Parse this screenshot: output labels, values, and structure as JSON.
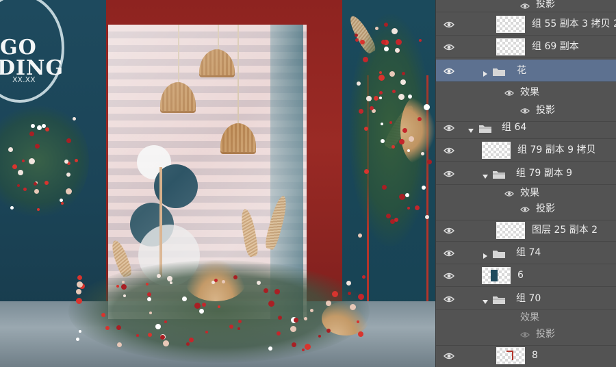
{
  "canvas": {
    "logo_lines": [
      "GO",
      "DING"
    ],
    "logo_small": "XX.XX",
    "colors": {
      "teal_wall": "#1f4a5c",
      "red_wall": "#8e2320",
      "glass": "#f0f2f4",
      "accent_red": "#b3352b"
    }
  },
  "layers": [
    {
      "kind": "effect-item",
      "label": "投影",
      "visible": true
    },
    {
      "kind": "layer",
      "label": "组 55 副本 3 拷贝 2",
      "thumb": "checker",
      "visible": true
    },
    {
      "kind": "layer",
      "label": "组 69 副本",
      "thumb": "checker",
      "visible": true
    },
    {
      "kind": "group",
      "label": "花",
      "expanded": false,
      "selected": true,
      "visible": true
    },
    {
      "kind": "effects-header",
      "label": "效果",
      "visible": true
    },
    {
      "kind": "effect-item",
      "label": "投影",
      "visible": true
    },
    {
      "kind": "group",
      "label": "组 64",
      "expanded": true,
      "visible": true
    },
    {
      "kind": "layer",
      "label": "组 79 副本 9 拷贝",
      "thumb": "checker",
      "visible": true
    },
    {
      "kind": "group",
      "label": "组 79 副本 9",
      "expanded": true,
      "visible": true
    },
    {
      "kind": "effects-header",
      "label": "效果",
      "visible": true
    },
    {
      "kind": "effect-item",
      "label": "投影",
      "visible": true
    },
    {
      "kind": "layer",
      "label": "图层 25 副本 2",
      "thumb": "checker",
      "visible": true
    },
    {
      "kind": "group",
      "label": "组 74",
      "expanded": false,
      "visible": true
    },
    {
      "kind": "layer",
      "label": "6",
      "thumb": "teal-rect",
      "visible": true
    },
    {
      "kind": "group",
      "label": "组 70",
      "expanded": true,
      "visible": true
    },
    {
      "kind": "effects-header",
      "label": "效果",
      "visible": false
    },
    {
      "kind": "effect-item",
      "label": "投影",
      "visible": false
    },
    {
      "kind": "layer",
      "label": "8",
      "thumb": "red-corner",
      "visible": true
    }
  ]
}
